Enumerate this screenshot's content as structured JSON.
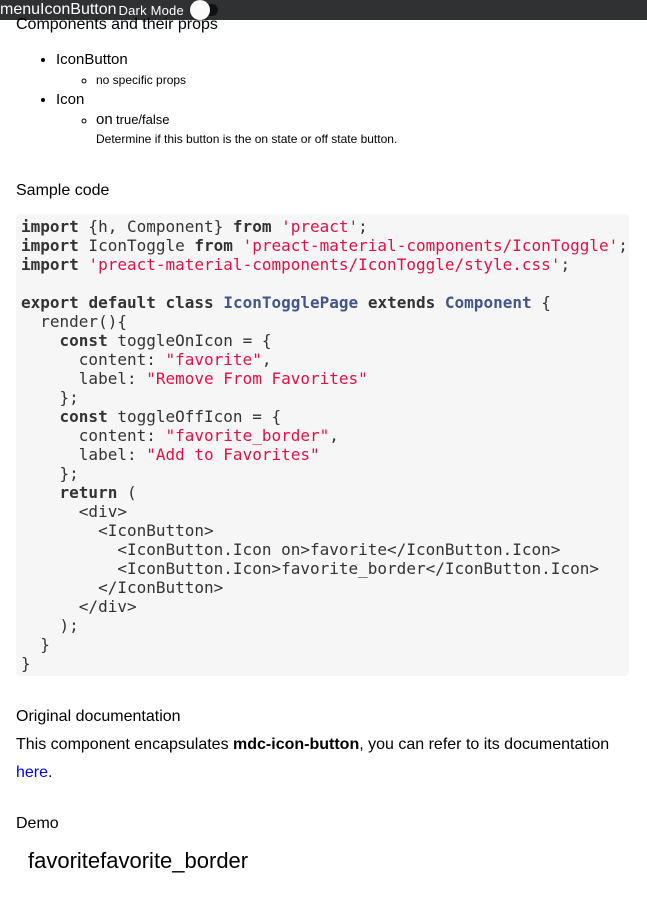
{
  "topbar": {
    "title": "menuIconButton",
    "mode_label": "Dark Mode"
  },
  "props_section": {
    "title": "Components and their props",
    "components": [
      {
        "name": "IconButton",
        "note": "no specific props"
      },
      {
        "name": "Icon",
        "prop_name": "on",
        "prop_type": "true/false",
        "prop_desc": "Determine if this button is the on state or off state button."
      }
    ]
  },
  "sample_section": {
    "title": "Sample code"
  },
  "code": {
    "l1": {
      "kw1": "import",
      "t1": " {h, Component} ",
      "kw2": "from",
      "t2": " ",
      "s1": "'preact'",
      "t3": ";"
    },
    "l2": {
      "kw1": "import",
      "t1": " IconToggle ",
      "kw2": "from",
      "t2": " ",
      "s1": "'preact-material-components/IconToggle'",
      "t3": ";"
    },
    "l3": {
      "kw1": "import",
      "t1": " ",
      "s1": "'preact-material-components/IconToggle/style.css'",
      "t2": ";"
    },
    "l5": {
      "kw1": "export",
      "t1": " ",
      "kw2": "default",
      "t2": " ",
      "kw3": "class",
      "t3": " ",
      "cls1": "IconTogglePage",
      "t4": " ",
      "kw4": "extends",
      "t5": " ",
      "cls2": "Component",
      "t6": " {"
    },
    "l6": "  render(){",
    "l7": {
      "ind": "    ",
      "kw": "const",
      "t": " toggleOnIcon = {"
    },
    "l8": {
      "t": "      content: ",
      "s": "\"favorite\"",
      "e": ","
    },
    "l9": {
      "t": "      label: ",
      "s": "\"Remove From Favorites\""
    },
    "l10": "    };",
    "l11": {
      "ind": "    ",
      "kw": "const",
      "t": " toggleOffIcon = {"
    },
    "l12": {
      "t": "      content: ",
      "s": "\"favorite_border\"",
      "e": ","
    },
    "l13": {
      "t": "      label: ",
      "s": "\"Add to Favorites\""
    },
    "l14": "    };",
    "l15": {
      "ind": "    ",
      "kw": "return",
      "t": " ("
    },
    "l16": "      <div>",
    "l17": "        <IconButton>",
    "l18": "          <IconButton.Icon on>favorite</IconButton.Icon>",
    "l19": "          <IconButton.Icon>favorite_border</IconButton.Icon>",
    "l20": "        </IconButton>",
    "l21": "      </div>",
    "l22": "    );",
    "l23": "  }",
    "l24": "}"
  },
  "docs": {
    "title": "Original documentation",
    "text_before": "This component encapsulates ",
    "bold": "mdc-icon-button",
    "text_after": ", you can refer to its documentation ",
    "link": "here",
    "end": "."
  },
  "demo": {
    "title": "Demo",
    "icons": "favoritefavorite_border"
  }
}
